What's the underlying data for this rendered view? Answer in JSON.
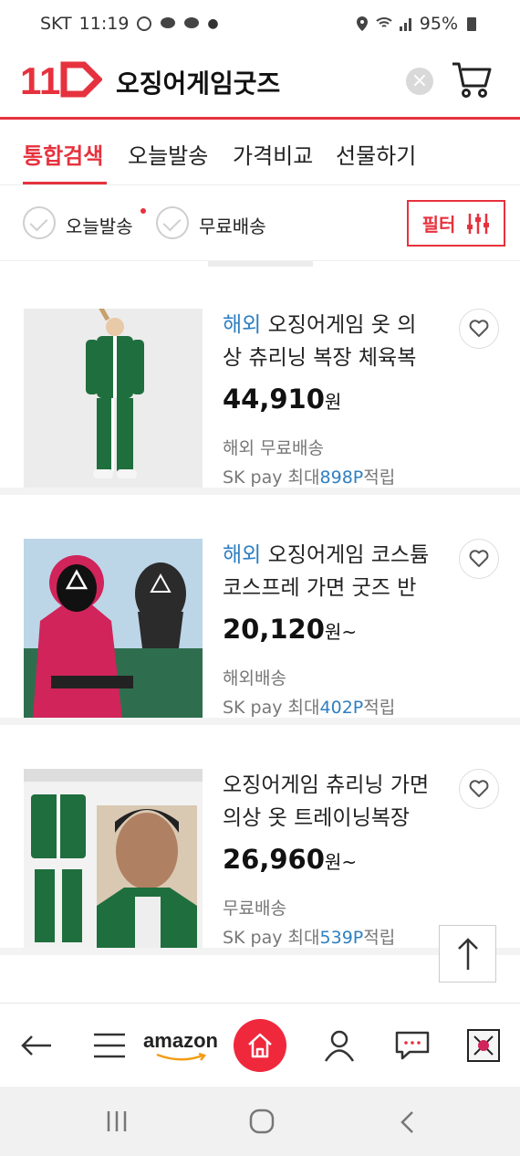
{
  "status_bar": {
    "carrier": "SKT",
    "time": "11:19",
    "battery": "95%"
  },
  "header": {
    "logo_text": "11",
    "search_query": "오징어게임굿즈"
  },
  "tabs": [
    {
      "label": "통합검색",
      "active": true
    },
    {
      "label": "오늘발송",
      "active": false
    },
    {
      "label": "가격비교",
      "active": false
    },
    {
      "label": "선물하기",
      "active": false
    }
  ],
  "filters": {
    "today_ship": "오늘발송",
    "free_ship": "무료배송",
    "filter_button": "필터"
  },
  "products": [
    {
      "tag": "해외",
      "title_line1": "오징어게임 옷 의",
      "title_line2": "상 츄리닝 복장 체육복",
      "price": "44,910",
      "won": "원",
      "shipping": "해외 무료배송",
      "pay_prefix": "SK pay 최대",
      "points": "898P",
      "pay_suffix": "적립"
    },
    {
      "tag": "해외",
      "title_line1": "오징어게임 코스튬",
      "title_line2": "코스프레 가면 굿즈 반",
      "price": "20,120",
      "won": "원~",
      "shipping": "해외배송",
      "pay_prefix": "SK pay 최대",
      "points": "402P",
      "pay_suffix": "적립"
    },
    {
      "tag": "",
      "title_line1": "오징어게임 츄리닝 가면",
      "title_line2": "의상 옷 트레이닝복장",
      "price": "26,960",
      "won": "원~",
      "shipping": "무료배송",
      "pay_prefix": "SK pay 최대",
      "points": "539P",
      "pay_suffix": "적립"
    }
  ],
  "bottom_nav": {
    "amazon_label": "amazon"
  },
  "icons": {
    "back": "back-arrow-icon",
    "menu": "hamburger-icon",
    "home": "home-icon",
    "user": "user-icon",
    "chat": "chat-icon",
    "cart": "cart-icon",
    "heart": "heart-icon",
    "top": "arrow-up-icon",
    "filter": "sliders-icon"
  },
  "colors": {
    "brand_red": "#e6323e",
    "link_blue": "#2f7fc1",
    "home_red": "#f0283c"
  }
}
